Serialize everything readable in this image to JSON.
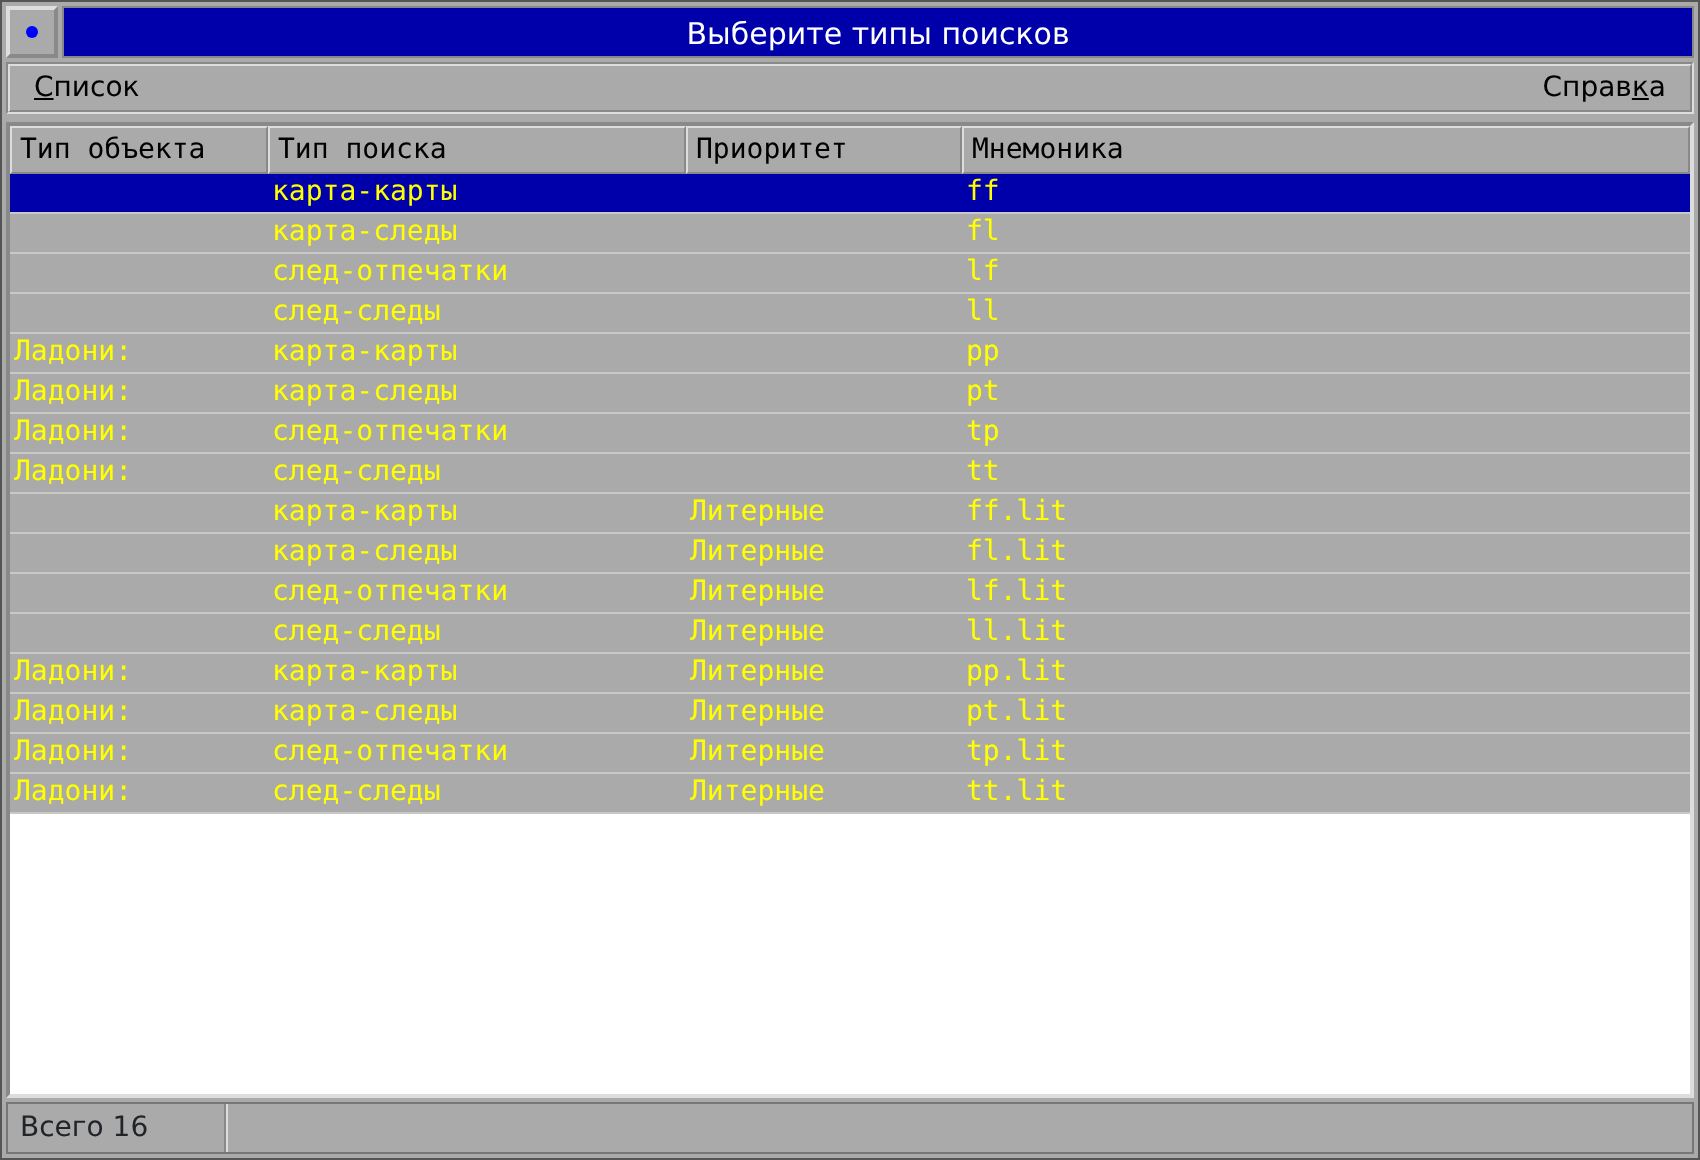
{
  "window": {
    "title": "Выберите типы поисков"
  },
  "menu": [
    {
      "underlined": "С",
      "after": "писок"
    },
    {
      "before": "Справ",
      "underlined": "к",
      "after": "а"
    }
  ],
  "table": {
    "columns": [
      "Тип объекта",
      "Тип поиска",
      "Приоритет",
      "Мнемоника"
    ],
    "rows": [
      {
        "selected": true,
        "search_type": "карта-карты",
        "mnemonic": "ff"
      },
      {
        "selected": false,
        "search_type": "карта-следы",
        "mnemonic": "fl"
      },
      {
        "selected": false,
        "search_type": "след-отпечатки",
        "mnemonic": "lf"
      },
      {
        "selected": false,
        "search_type": "след-следы",
        "mnemonic": "ll"
      },
      {
        "selected": false,
        "object_type": "Ладони:",
        "search_type": "карта-карты",
        "mnemonic": "pp"
      },
      {
        "selected": false,
        "object_type": "Ладони:",
        "search_type": "карта-следы",
        "mnemonic": "pt"
      },
      {
        "selected": false,
        "object_type": "Ладони:",
        "search_type": "след-отпечатки",
        "mnemonic": "tp"
      },
      {
        "selected": false,
        "object_type": "Ладони:",
        "search_type": "след-следы",
        "mnemonic": "tt"
      },
      {
        "selected": false,
        "search_type": "карта-карты",
        "priority": "Литерные",
        "mnemonic": "ff.lit"
      },
      {
        "selected": false,
        "search_type": "карта-следы",
        "priority": "Литерные",
        "mnemonic": "fl.lit"
      },
      {
        "selected": false,
        "search_type": "след-отпечатки",
        "priority": "Литерные",
        "mnemonic": "lf.lit"
      },
      {
        "selected": false,
        "search_type": "след-следы",
        "priority": "Литерные",
        "mnemonic": "ll.lit"
      },
      {
        "selected": false,
        "object_type": "Ладони:",
        "search_type": "карта-карты",
        "priority": "Литерные",
        "mnemonic": "pp.lit"
      },
      {
        "selected": false,
        "object_type": "Ладони:",
        "search_type": "карта-следы",
        "priority": "Литерные",
        "mnemonic": "pt.lit"
      },
      {
        "selected": false,
        "object_type": "Ладони:",
        "search_type": "след-отпечатки",
        "priority": "Литерные",
        "mnemonic": "tp.lit"
      },
      {
        "selected": false,
        "object_type": "Ладони:",
        "search_type": "след-следы",
        "priority": "Литерные",
        "mnemonic": "tt.lit"
      }
    ]
  },
  "status_bar": {
    "total": "Всего 16"
  }
}
